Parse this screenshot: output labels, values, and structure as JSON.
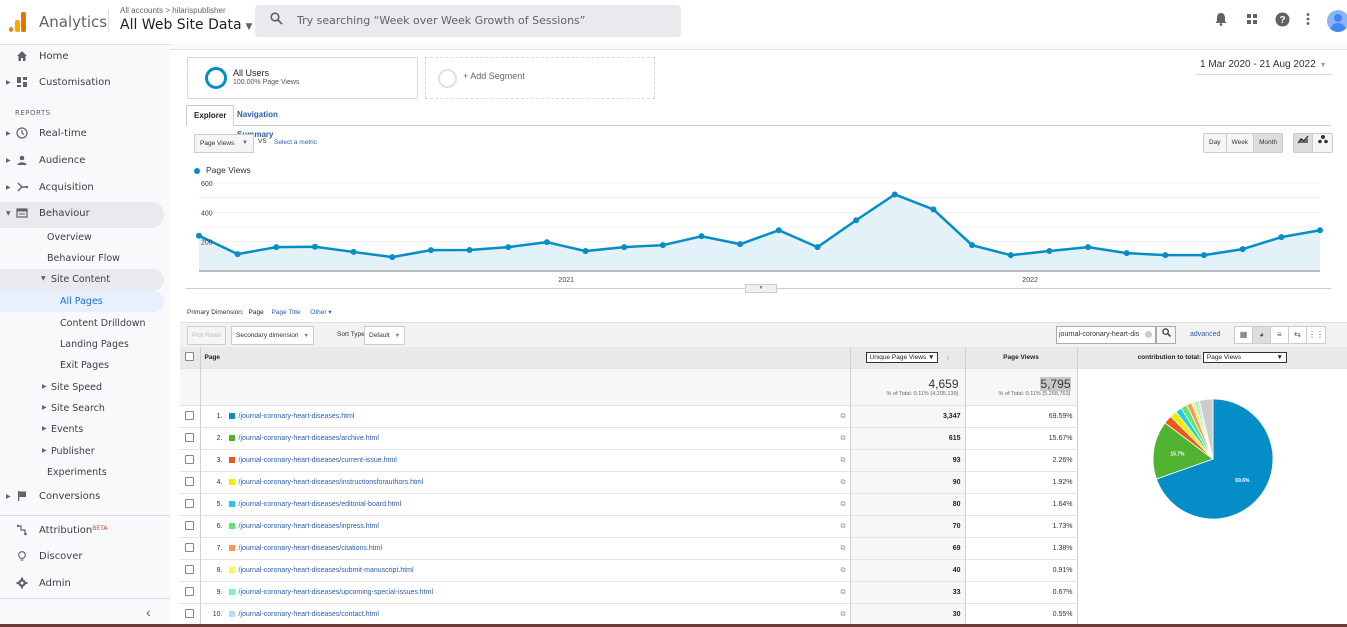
{
  "header": {
    "app_name": "Analytics",
    "breadcrumb": "All accounts > hilarispublisher",
    "property": "All Web Site Data",
    "search_placeholder": "Try searching “Week over Week Growth of Sessions”",
    "icons": [
      "bell-icon",
      "apps-icon",
      "help-icon",
      "more-icon",
      "avatar"
    ]
  },
  "sidebar": {
    "top_items": [
      {
        "label": "Home",
        "icon": "home-icon"
      },
      {
        "label": "Customisation",
        "icon": "dashboard-icon"
      }
    ],
    "reports_label": "REPORTS",
    "items": [
      {
        "label": "Real-time",
        "icon": "clock-icon"
      },
      {
        "label": "Audience",
        "icon": "person-icon"
      },
      {
        "label": "Acquisition",
        "icon": "acquisition-icon"
      },
      {
        "label": "Behaviour",
        "icon": "behaviour-icon"
      }
    ],
    "behaviour_sub": [
      "Overview",
      "Behaviour Flow"
    ],
    "site_content": "Site Content",
    "site_content_sub": [
      "All Pages",
      "Content Drilldown",
      "Landing Pages",
      "Exit Pages"
    ],
    "more_sub": [
      "Site Speed",
      "Site Search",
      "Events",
      "Publisher"
    ],
    "experiments": "Experiments",
    "conversions": "Conversions",
    "bottom_items": [
      {
        "label": "Attribution",
        "badge": "BETA"
      },
      {
        "label": "Discover"
      },
      {
        "label": "Admin"
      }
    ],
    "collapse_icon": "‹"
  },
  "segments": {
    "active": {
      "name": "All Users",
      "detail": "100.00% Page Views"
    },
    "add_label": "+ Add Segment"
  },
  "date_range": "1 Mar 2020 - 21 Aug 2022",
  "tabs": [
    "Explorer",
    "Navigation Summary"
  ],
  "metric_selector": {
    "selected": "Page Views",
    "vs": "VS",
    "select_metric": "Select a metric"
  },
  "granularity": {
    "options": [
      "Day",
      "Week",
      "Month"
    ],
    "selected": "Month"
  },
  "chart_data": {
    "type": "line",
    "title": "",
    "legend": [
      "Page Views"
    ],
    "xlabel": "",
    "ylabel": "",
    "x_tick_labels": [
      "2021",
      "2022"
    ],
    "y_ticks": [
      200,
      400,
      600
    ],
    "ylim": [
      0,
      650
    ],
    "color": "#058dc7",
    "x": [
      "Mar 2020",
      "Apr 2020",
      "May 2020",
      "Jun 2020",
      "Jul 2020",
      "Aug 2020",
      "Sep 2020",
      "Oct 2020",
      "Nov 2020",
      "Dec 2020",
      "Jan 2021",
      "Feb 2021",
      "Mar 2021",
      "Apr 2021",
      "May 2021",
      "Jun 2021",
      "Jul 2021",
      "Aug 2021",
      "Sep 2021",
      "Oct 2021",
      "Nov 2021",
      "Dec 2021",
      "Jan 2022",
      "Feb 2022",
      "Mar 2022",
      "Apr 2022",
      "May 2022",
      "Jun 2022",
      "Jul 2022",
      "Aug 2022"
    ],
    "series": [
      {
        "name": "Page Views",
        "values": [
          240,
          115,
          163,
          165,
          130,
          95,
          142,
          143,
          163,
          197,
          136,
          163,
          176,
          237,
          183,
          278,
          163,
          346,
          522,
          420,
          176,
          108,
          136,
          163,
          122,
          108,
          108,
          149,
          231,
          278
        ]
      }
    ]
  },
  "primary_dimension": {
    "label": "Primary Dimension:",
    "current": "Page",
    "options": [
      "Page Title",
      "Other"
    ]
  },
  "toolbar": {
    "plot_rows": "Plot Rows",
    "secondary_dimension": "Secondary dimension",
    "sort_type_label": "Sort Type:",
    "sort_type": "Default",
    "filter_value": "journal-coronary-heart-dis",
    "advanced": "advanced"
  },
  "table": {
    "headers": {
      "page": "Page",
      "unique_page_views": "Unique Page Views",
      "page_views": "Page Views",
      "contribution": "contribution to total:",
      "contribution_metric": "Page Views"
    },
    "totals": {
      "unique_page_views": "4,659",
      "unique_page_views_sub": "% of Total: 0.11% (4,205,139)",
      "page_views": "5,795",
      "page_views_sub": "% of Total: 0.11% (5,268,763)"
    },
    "rows": [
      {
        "n": "1.",
        "page": "/journal-coronary-heart-diseases.html",
        "color": "#058dc7",
        "unique": "3,347",
        "pct": "69.59%"
      },
      {
        "n": "2.",
        "page": "/journal-coronary-heart-diseases/archive.html",
        "color": "#50b432",
        "unique": "615",
        "pct": "15.67%"
      },
      {
        "n": "3.",
        "page": "/journal-coronary-heart-diseases/current-issue.html",
        "color": "#ed561b",
        "unique": "93",
        "pct": "2.26%"
      },
      {
        "n": "4.",
        "page": "/journal-coronary-heart-diseases/instructionsforauthors.html",
        "color": "#edef00",
        "unique": "90",
        "pct": "1.92%"
      },
      {
        "n": "5.",
        "page": "/journal-coronary-heart-diseases/editorial-board.html",
        "color": "#24cbe5",
        "unique": "80",
        "pct": "1.64%"
      },
      {
        "n": "6.",
        "page": "/journal-coronary-heart-diseases/inpress.html",
        "color": "#64e572",
        "unique": "70",
        "pct": "1.73%"
      },
      {
        "n": "7.",
        "page": "/journal-coronary-heart-diseases/citations.html",
        "color": "#ff9655",
        "unique": "69",
        "pct": "1.38%"
      },
      {
        "n": "8.",
        "page": "/journal-coronary-heart-diseases/submit-manuscript.html",
        "color": "#fff263",
        "unique": "40",
        "pct": "0.91%"
      },
      {
        "n": "9.",
        "page": "/journal-coronary-heart-diseases/upcoming-special-issues.html",
        "color": "#6af9c4",
        "unique": "33",
        "pct": "0.67%"
      },
      {
        "n": "10.",
        "page": "/journal-coronary-heart-diseases/contact.html",
        "color": "#b2deff",
        "unique": "30",
        "pct": "0.55%"
      }
    ],
    "pie": {
      "other_color": "#cccccc",
      "other_pct": 3.68,
      "labels": [
        "69.6%",
        "15.7%"
      ]
    }
  }
}
